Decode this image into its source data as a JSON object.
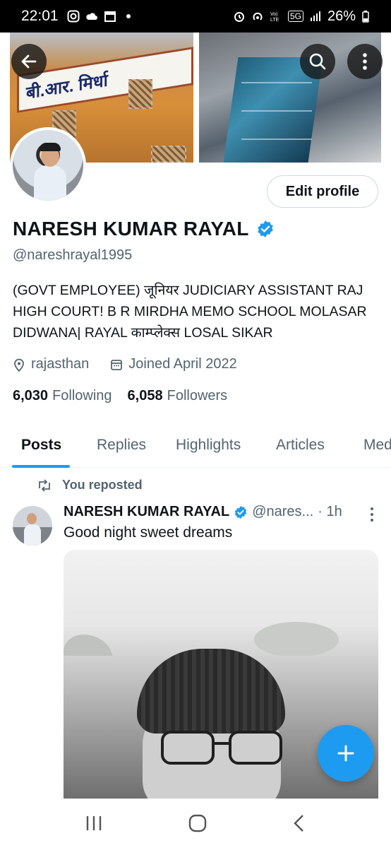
{
  "status_bar": {
    "time": "22:01",
    "network": "5G",
    "battery": "26%",
    "icons": [
      "instagram-icon",
      "cloud-icon",
      "calendar-icon",
      "dot-icon",
      "alarm-icon",
      "hotspot-icon",
      "volte-icon",
      "signal-icon",
      "battery-icon"
    ]
  },
  "header": {
    "back_icon": "back-arrow-icon",
    "search_icon": "search-icon",
    "more_icon": "more-vertical-icon"
  },
  "profile": {
    "edit_profile_label": "Edit profile",
    "display_name": "NARESH KUMAR RAYAL",
    "handle": "@nareshrayal1995",
    "bio": "(GOVT EMPLOYEE) जूनियर JUDICIARY ASSISTANT RAJ HIGH COURT! B R MIRDHA MEMO SCHOOL MOLASAR DIDWANA| RAYAL काम्प्लेक्स LOSAL SIKAR",
    "location": "rajasthan",
    "joined": "Joined April 2022",
    "following_count": "6,030",
    "following_label": "Following",
    "followers_count": "6,058",
    "followers_label": "Followers"
  },
  "banner": {
    "sign_text": "बी.आर. मिर्धा"
  },
  "tabs": [
    {
      "label": "Posts",
      "active": true
    },
    {
      "label": "Replies",
      "active": false
    },
    {
      "label": "Highlights",
      "active": false
    },
    {
      "label": "Articles",
      "active": false
    },
    {
      "label": "Med",
      "active": false
    }
  ],
  "post": {
    "repost_label": "You reposted",
    "author_name": "NARESH KUMAR RAYAL",
    "author_handle": "@nares...",
    "time": "· 1h",
    "text": "Good night sweet dreams"
  },
  "colors": {
    "accent": "#1d9bf0",
    "text_primary": "#0f1419",
    "text_secondary": "#536471"
  }
}
